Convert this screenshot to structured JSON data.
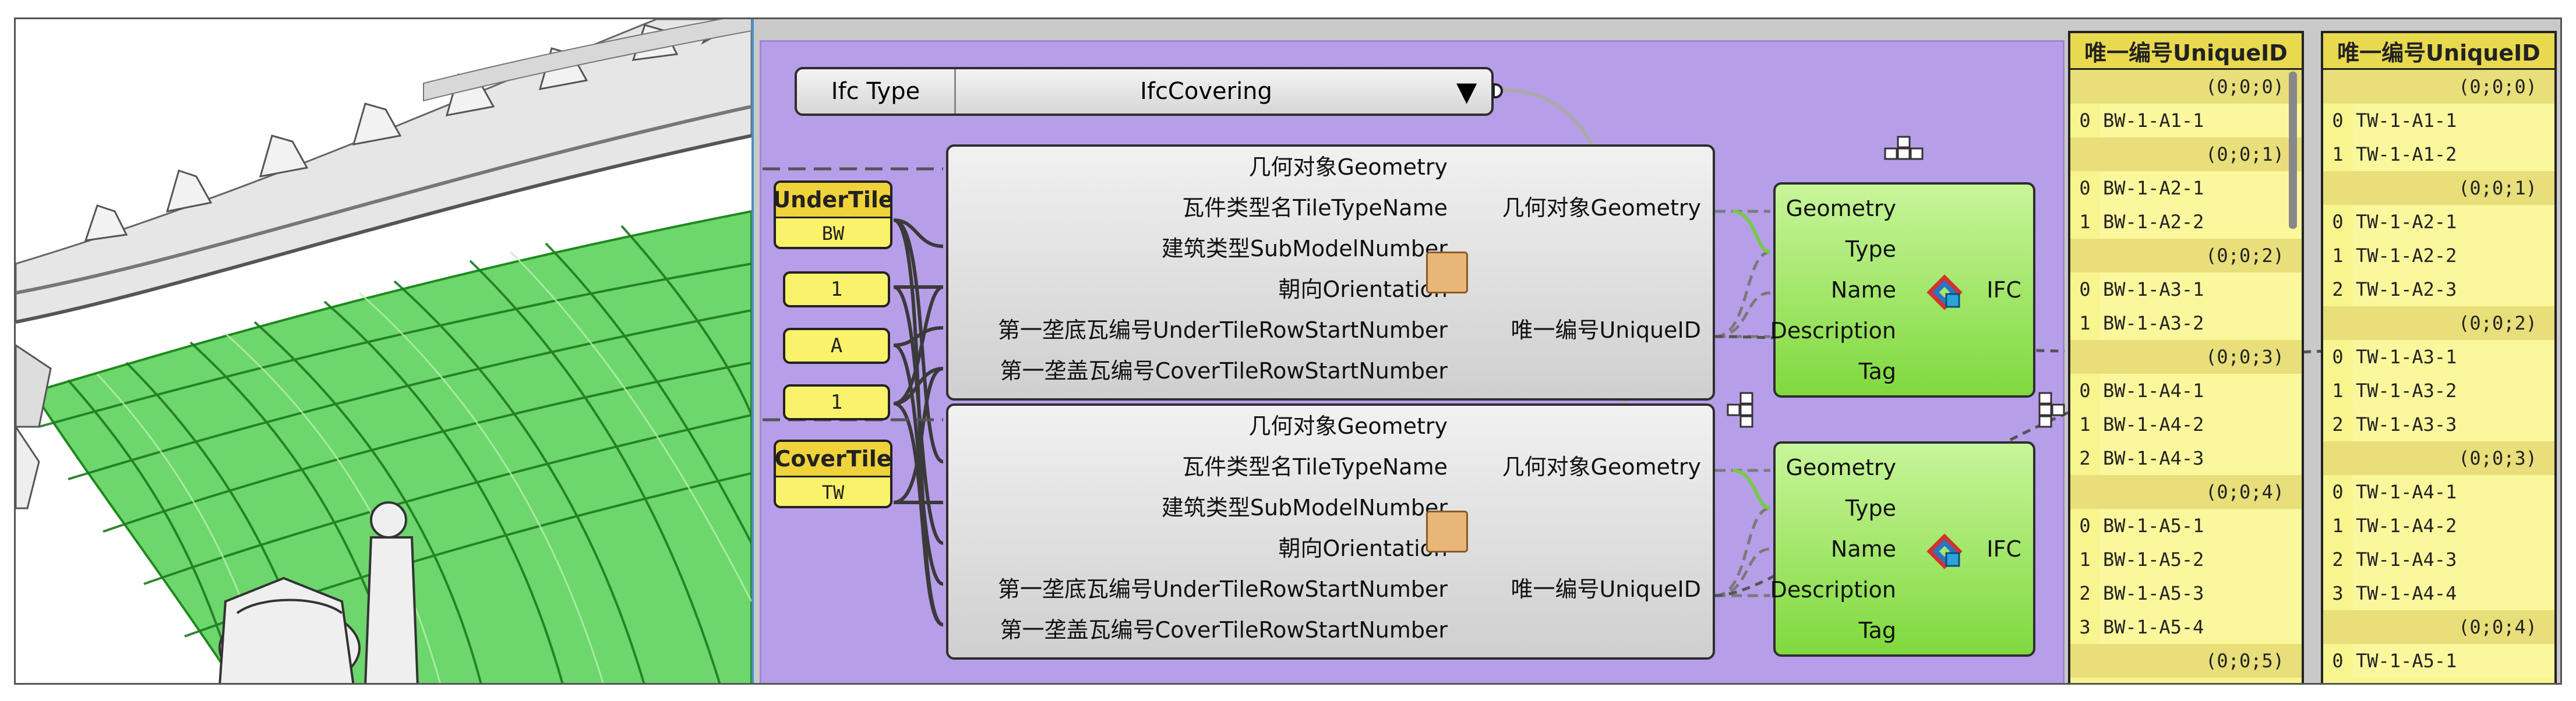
{
  "ifc_type": {
    "label": "Ifc Type",
    "value": "IfcCovering"
  },
  "params": [
    {
      "name": "UnderTile",
      "value": "BW"
    },
    {
      "name": "CoverTile",
      "value": "TW"
    }
  ],
  "number_inputs": [
    "1",
    "A",
    "1"
  ],
  "tile_component": {
    "inputs": [
      "几何对象Geometry",
      "瓦件类型名TileTypeName",
      "建筑类型SubModelNumber",
      "朝向Orientation",
      "第一垄底瓦编号UnderTileRowStartNumber",
      "第一垄盖瓦编号CoverTileRowStartNumber"
    ],
    "outputs": [
      "几何对象Geometry",
      "唯一编号UniqueID"
    ]
  },
  "ifc_component": {
    "inputs": [
      "Geometry",
      "Type",
      "Name",
      "Description",
      "Tag"
    ],
    "output": "IFC"
  },
  "panel_under": {
    "title": "唯一编号UniqueID",
    "rows": [
      {
        "path": "(0;0;0)"
      },
      {
        "idx": "0",
        "val": "BW-1-A1-1"
      },
      {
        "path": "(0;0;1)"
      },
      {
        "idx": "0",
        "val": "BW-1-A2-1"
      },
      {
        "idx": "1",
        "val": "BW-1-A2-2"
      },
      {
        "path": "(0;0;2)"
      },
      {
        "idx": "0",
        "val": "BW-1-A3-1"
      },
      {
        "idx": "1",
        "val": "BW-1-A3-2"
      },
      {
        "path": "(0;0;3)"
      },
      {
        "idx": "0",
        "val": "BW-1-A4-1"
      },
      {
        "idx": "1",
        "val": "BW-1-A4-2"
      },
      {
        "idx": "2",
        "val": "BW-1-A4-3"
      },
      {
        "path": "(0;0;4)"
      },
      {
        "idx": "0",
        "val": "BW-1-A5-1"
      },
      {
        "idx": "1",
        "val": "BW-1-A5-2"
      },
      {
        "idx": "2",
        "val": "BW-1-A5-3"
      },
      {
        "idx": "3",
        "val": "BW-1-A5-4"
      },
      {
        "path": "(0;0;5)"
      }
    ]
  },
  "panel_cover": {
    "title": "唯一编号UniqueID",
    "rows": [
      {
        "path": "(0;0;0)"
      },
      {
        "idx": "0",
        "val": "TW-1-A1-1"
      },
      {
        "idx": "1",
        "val": "TW-1-A1-2"
      },
      {
        "path": "(0;0;1)"
      },
      {
        "idx": "0",
        "val": "TW-1-A2-1"
      },
      {
        "idx": "1",
        "val": "TW-1-A2-2"
      },
      {
        "idx": "2",
        "val": "TW-1-A2-3"
      },
      {
        "path": "(0;0;2)"
      },
      {
        "idx": "0",
        "val": "TW-1-A3-1"
      },
      {
        "idx": "1",
        "val": "TW-1-A3-2"
      },
      {
        "idx": "2",
        "val": "TW-1-A3-3"
      },
      {
        "path": "(0;0;3)"
      },
      {
        "idx": "0",
        "val": "TW-1-A4-1"
      },
      {
        "idx": "1",
        "val": "TW-1-A4-2"
      },
      {
        "idx": "2",
        "val": "TW-1-A4-3"
      },
      {
        "idx": "3",
        "val": "TW-1-A4-4"
      },
      {
        "path": "(0;0;4)"
      },
      {
        "idx": "0",
        "val": "TW-1-A5-1"
      }
    ]
  },
  "colors": {
    "group": "#b79ee9",
    "ifc_green": "#7fd93e",
    "panel_yellow": "#f8f48e",
    "tile_green": "#3cc83c"
  }
}
